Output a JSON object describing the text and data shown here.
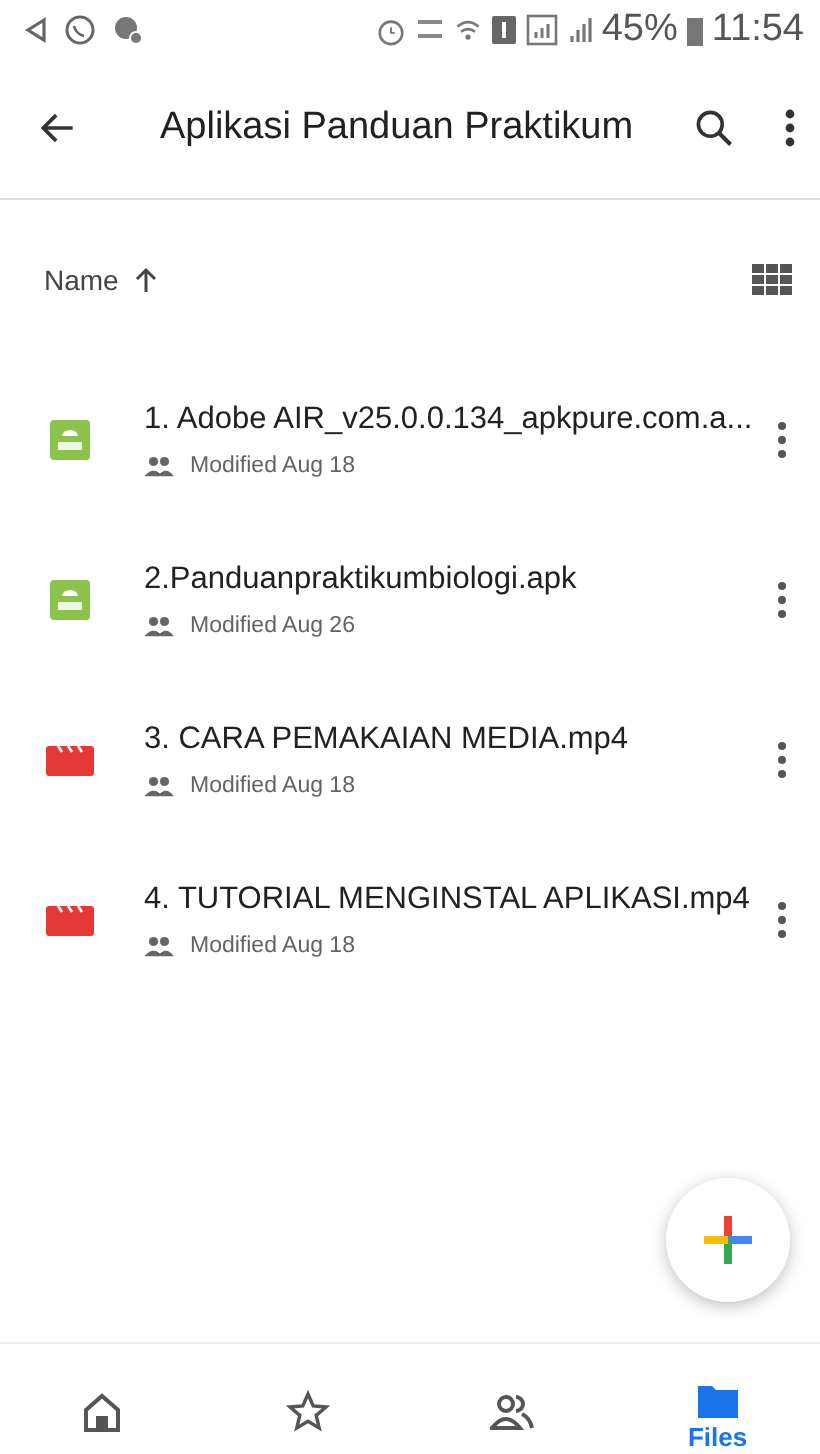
{
  "status_bar": {
    "battery": "45%",
    "time": "11:54"
  },
  "app_bar": {
    "title": "Aplikasi Panduan Praktikum"
  },
  "sort": {
    "label": "Name"
  },
  "files": [
    {
      "kind": "apk",
      "name": "1. Adobe AIR_v25.0.0.134_apkpure.com.a...",
      "modified": "Modified Aug 18"
    },
    {
      "kind": "apk",
      "name": "2.Panduanpraktikumbiologi.apk",
      "modified": "Modified Aug 26"
    },
    {
      "kind": "video",
      "name": "3. CARA PEMAKAIAN MEDIA.mp4",
      "modified": "Modified Aug 18"
    },
    {
      "kind": "video",
      "name": "4. TUTORIAL MENGINSTAL APLIKASI.mp4",
      "modified": "Modified Aug 18"
    }
  ],
  "bottom_nav": [
    {
      "kind": "home",
      "selected": false
    },
    {
      "kind": "starred",
      "selected": false
    },
    {
      "kind": "shared",
      "selected": false
    },
    {
      "kind": "files",
      "label": "Files",
      "selected": true
    }
  ]
}
